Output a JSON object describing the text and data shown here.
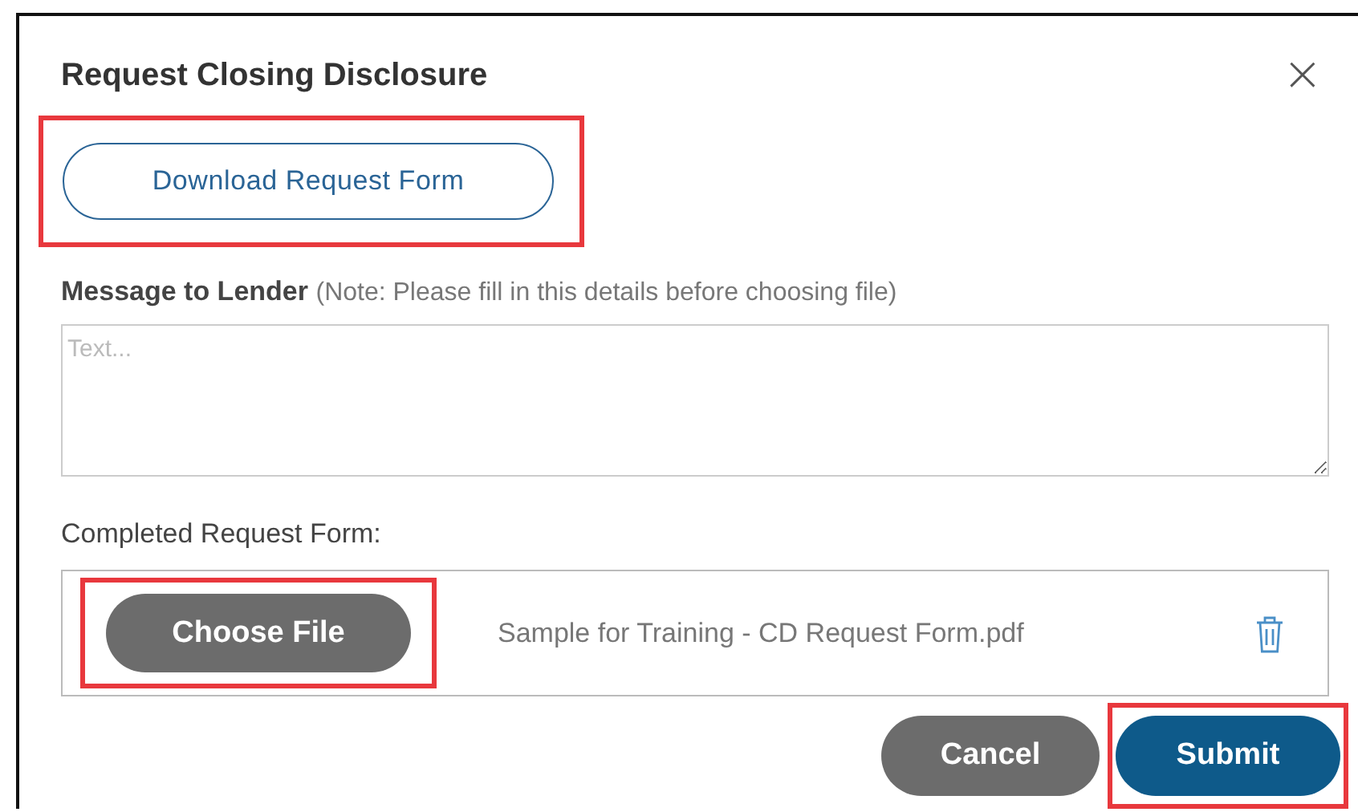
{
  "dialog": {
    "title": "Request Closing Disclosure",
    "close": "×"
  },
  "download_button": {
    "label": "Download Request Form",
    "highlighted": true
  },
  "message": {
    "label": "Message to Lender",
    "note": "(Note: Please fill in this details before choosing file)",
    "placeholder": "Text..."
  },
  "upload": {
    "label": "Completed Request Form:",
    "choose_button": {
      "label": "Choose File",
      "highlighted": true
    },
    "file_name": "Sample for Training - CD Request Form.pdf"
  },
  "buttons": [
    {
      "kind": "secondary",
      "label": "Cancel",
      "highlighted": false
    },
    {
      "kind": "primary",
      "label": "Submit",
      "highlighted": true
    }
  ]
}
